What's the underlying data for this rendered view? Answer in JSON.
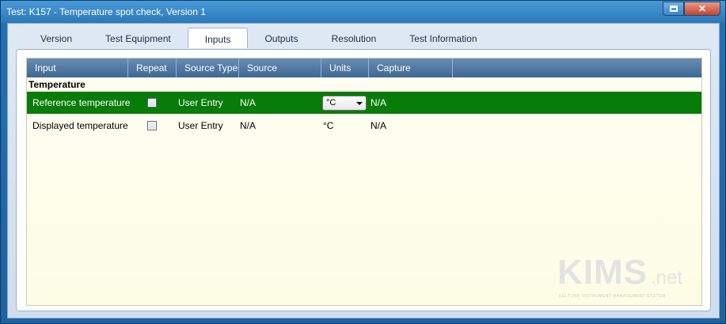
{
  "window": {
    "title": "Test: K157 - Temperature spot check, Version 1"
  },
  "tabs": [
    {
      "label": "Version",
      "active": false
    },
    {
      "label": "Test Equipment",
      "active": false
    },
    {
      "label": "Inputs",
      "active": true
    },
    {
      "label": "Outputs",
      "active": false
    },
    {
      "label": "Resolution",
      "active": false
    },
    {
      "label": "Test Information",
      "active": false
    }
  ],
  "grid": {
    "columns": [
      "Input",
      "Repeat",
      "Source Type",
      "Source",
      "Units",
      "Capture"
    ],
    "group_label": "Temperature",
    "rows": [
      {
        "input": "Reference temperature",
        "repeat": false,
        "source_type": "User Entry",
        "source": "N/A",
        "units": "°C",
        "units_dropdown": true,
        "capture": "N/A",
        "selected": true
      },
      {
        "input": "Displayed temperature",
        "repeat": false,
        "source_type": "User Entry",
        "source": "N/A",
        "units": "°C",
        "units_dropdown": false,
        "capture": "N/A",
        "selected": false
      }
    ]
  },
  "logo": {
    "main": "KIMS",
    "suffix": ".net",
    "tagline": "KELTON® INSTRUMENT MANAGEMENT SYSTEM"
  },
  "colors": {
    "selected_row": "#087c08",
    "header": "#4a729c",
    "grid_bg": "#fdfde6"
  }
}
